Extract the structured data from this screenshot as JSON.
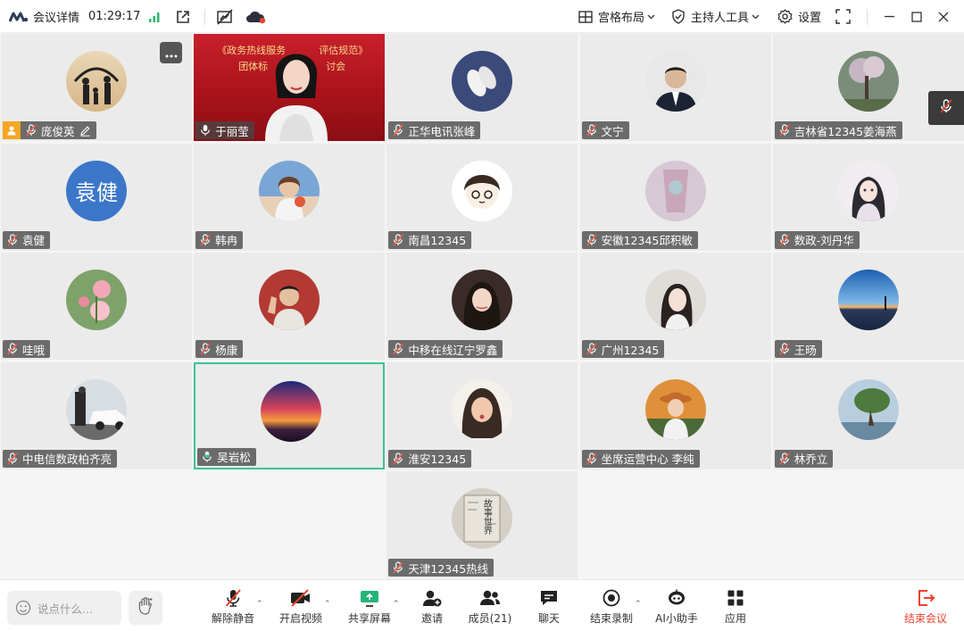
{
  "topbar": {
    "meeting_details": "会议详情",
    "timer": "01:29:17",
    "grid_layout": "宫格布局",
    "host_tools": "主持人工具",
    "settings": "设置"
  },
  "participants": [
    {
      "name": "庞俊英",
      "col": 0,
      "row": 0,
      "avatar": "family-silhouette",
      "host": true,
      "mic": "muted",
      "edit": true
    },
    {
      "name": "于丽莹",
      "col": 1,
      "row": 0,
      "avatar": "video",
      "mic": "on",
      "video_text_line1": "《政务热线服务",
      "video_text_mid": "评估规范》",
      "video_text_line2": "团体标",
      "video_text_tail": "讨会"
    },
    {
      "name": "正华电讯张峰",
      "col": 2,
      "row": 0,
      "avatar": "white-shoes",
      "mic": "muted"
    },
    {
      "name": "文宁",
      "col": 3,
      "row": 0,
      "avatar": "man-suit",
      "mic": "muted"
    },
    {
      "name": "吉林省12345姜海燕",
      "col": 4,
      "row": 0,
      "avatar": "blossom-tree",
      "mic": "muted"
    },
    {
      "name": "袁健",
      "col": 0,
      "row": 1,
      "avatar": "text",
      "avatar_text": "袁健",
      "mic": "muted"
    },
    {
      "name": "韩冉",
      "col": 1,
      "row": 1,
      "avatar": "girl-sun",
      "mic": "muted"
    },
    {
      "name": "南昌12345",
      "col": 2,
      "row": 1,
      "avatar": "cartoon-girl",
      "mic": "muted"
    },
    {
      "name": "安徽12345邱积敏",
      "col": 3,
      "row": 1,
      "avatar": "pink-wall",
      "mic": "muted"
    },
    {
      "name": "数政-刘丹华",
      "col": 4,
      "row": 1,
      "avatar": "anime-girl",
      "mic": "muted"
    },
    {
      "name": "哇哦",
      "col": 0,
      "row": 2,
      "avatar": "pink-flowers",
      "mic": "muted"
    },
    {
      "name": "杨康",
      "col": 1,
      "row": 2,
      "avatar": "boy-wave",
      "mic": "muted"
    },
    {
      "name": "中移在线辽宁罗鑫",
      "col": 2,
      "row": 2,
      "avatar": "woman-portrait",
      "mic": "muted"
    },
    {
      "name": "广州12345",
      "col": 3,
      "row": 2,
      "avatar": "woman-light",
      "mic": "muted"
    },
    {
      "name": "王旸",
      "col": 4,
      "row": 2,
      "avatar": "sunset-sea",
      "mic": "muted"
    },
    {
      "name": "中电信数政柏齐亮",
      "col": 0,
      "row": 3,
      "avatar": "car-white",
      "mic": "muted"
    },
    {
      "name": "吴岩松",
      "col": 1,
      "row": 3,
      "avatar": "sunset-sky",
      "mic": "speaking",
      "active": true
    },
    {
      "name": "淮安12345",
      "col": 2,
      "row": 3,
      "avatar": "woman-pout",
      "mic": "muted"
    },
    {
      "name": "坐席运营中心 李纯",
      "col": 3,
      "row": 3,
      "avatar": "woman-hat",
      "mic": "muted"
    },
    {
      "name": "林乔立",
      "col": 4,
      "row": 3,
      "avatar": "lone-tree",
      "mic": "muted"
    },
    {
      "name": "天津12345热线",
      "col": 2,
      "row": 4,
      "avatar": "book-cover",
      "mic": "muted",
      "avatar_text": "故事世界"
    }
  ],
  "bottombar": {
    "chat_placeholder": "说点什么...",
    "unmute": "解除静音",
    "start_video": "开启视频",
    "share_screen": "共享屏幕",
    "invite": "邀请",
    "members": "成员(21)",
    "chat": "聊天",
    "end_recording": "结束录制",
    "ai_assistant": "AI小助手",
    "apps": "应用",
    "end_meeting": "结束会议"
  },
  "colors": {
    "accent_green": "#3dc48f",
    "signal_green": "#2fb36e",
    "end_red": "#e8432e",
    "host_orange": "#f5a623",
    "yuanjian_blue": "#3b76c9"
  }
}
